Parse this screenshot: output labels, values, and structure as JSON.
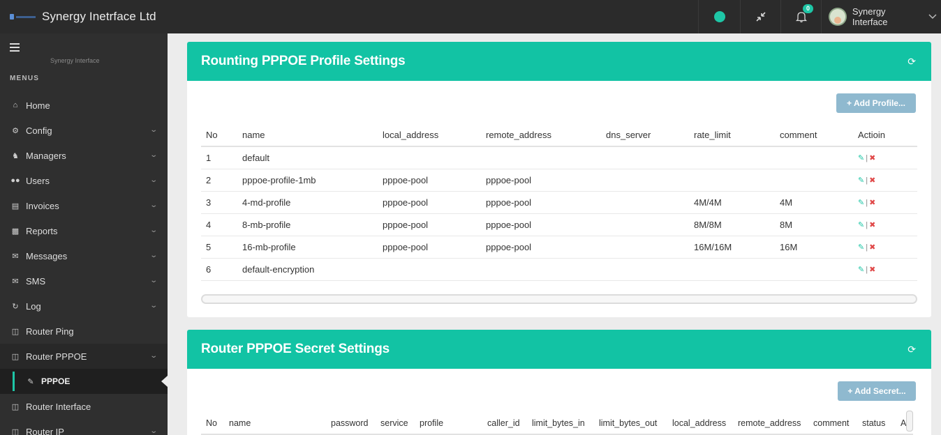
{
  "topbar": {
    "brand_title": "Synergy Inetrface Ltd",
    "notification_count": "0",
    "user_name": "Synergy Interface",
    "status_color": "#1ec6a6"
  },
  "sidebar": {
    "subtitle": "Synergy Interface",
    "menus_title": "MENUS",
    "items": [
      {
        "label": "Home",
        "icon": "home-icon"
      },
      {
        "label": "Config",
        "icon": "gear-icon"
      },
      {
        "label": "Managers",
        "icon": "manager-icon"
      },
      {
        "label": "Users",
        "icon": "users-icon"
      },
      {
        "label": "Invoices",
        "icon": "invoice-icon"
      },
      {
        "label": "Reports",
        "icon": "chart-icon"
      },
      {
        "label": "Messages",
        "icon": "messages-icon"
      },
      {
        "label": "SMS",
        "icon": "sms-icon"
      },
      {
        "label": "Log",
        "icon": "history-icon"
      },
      {
        "label": "Router Ping",
        "icon": "router-icon"
      },
      {
        "label": "Router PPPOE",
        "icon": "router-icon"
      },
      {
        "label": "PPPOE",
        "icon": "edit-icon"
      },
      {
        "label": "Router Interface",
        "icon": "router-icon"
      },
      {
        "label": "Router IP",
        "icon": "router-icon"
      }
    ]
  },
  "profile_panel": {
    "title": "Rounting PPPOE Profile Settings",
    "add_button": "+ Add Profile...",
    "columns": [
      "No",
      "name",
      "local_address",
      "remote_address",
      "dns_server",
      "rate_limit",
      "comment",
      "Actioin"
    ],
    "rows": [
      [
        "1",
        "default",
        "",
        "",
        "",
        "",
        ""
      ],
      [
        "2",
        "pppoe-profile-1mb",
        "pppoe-pool",
        "pppoe-pool",
        "",
        "",
        ""
      ],
      [
        "3",
        "4-md-profile",
        "pppoe-pool",
        "pppoe-pool",
        "",
        "4M/4M",
        "4M"
      ],
      [
        "4",
        "8-mb-profile",
        "pppoe-pool",
        "pppoe-pool",
        "",
        "8M/8M",
        "8M"
      ],
      [
        "5",
        "16-mb-profile",
        "pppoe-pool",
        "pppoe-pool",
        "",
        "16M/16M",
        "16M"
      ],
      [
        "6",
        "default-encryption",
        "",
        "",
        "",
        "",
        ""
      ]
    ],
    "action_separator": "|"
  },
  "secret_panel": {
    "title": "Router PPPOE Secret Settings",
    "add_button": "+ Add Secret...",
    "columns": [
      "No",
      "name",
      "password",
      "service",
      "profile",
      "caller_id",
      "limit_bytes_in",
      "limit_bytes_out",
      "local_address",
      "remote_address",
      "comment",
      "status",
      "Ac"
    ]
  },
  "colors": {
    "accent": "#12c3a4",
    "sidebar_bg": "#2f2f2f",
    "topbar_bg": "#2b2b2b",
    "delete": "#e04848",
    "button": "#8fb9cf"
  }
}
